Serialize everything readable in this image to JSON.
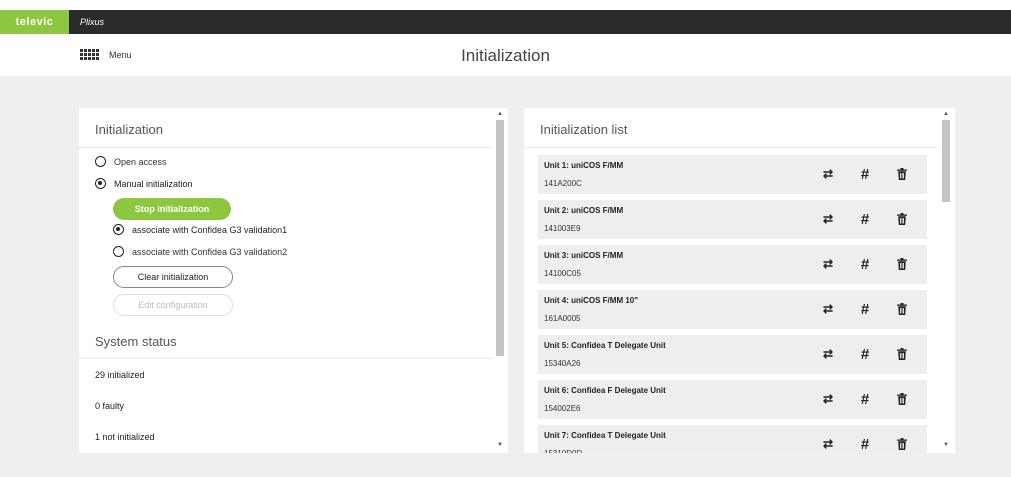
{
  "brand": {
    "logo": "televic",
    "app_name": "Plixus",
    "accent": "#8dc63f"
  },
  "header": {
    "menu_label": "Menu",
    "page_title": "Initialization"
  },
  "left_panel": {
    "title": "Initialization",
    "options": [
      {
        "label": "Open access",
        "checked": false
      },
      {
        "label": "Manual initialization",
        "checked": true
      }
    ],
    "stop_button": "Stop initialization",
    "associate_options": [
      {
        "label": "associate with Confidea G3 validation1",
        "checked": true
      },
      {
        "label": "associate with Confidea G3 validation2",
        "checked": false
      }
    ],
    "clear_button": "Clear initialization",
    "edit_button": "Edit configuration",
    "status_title": "System status",
    "status": [
      {
        "text": "29 initialized"
      },
      {
        "text": "0  faulty"
      },
      {
        "text": "1  not initialized"
      }
    ]
  },
  "right_panel": {
    "title": "Initialization list",
    "units": [
      {
        "name": "Unit 1: uniCOS F/MM",
        "serial": "141A200C"
      },
      {
        "name": "Unit 2: uniCOS F/MM",
        "serial": "141003E9"
      },
      {
        "name": "Unit 3: uniCOS F/MM",
        "serial": "14100C05"
      },
      {
        "name": "Unit 4: uniCOS F/MM 10\"",
        "serial": "161A0005"
      },
      {
        "name": "Unit 5: Confidea T Delegate Unit",
        "serial": "15340A26"
      },
      {
        "name": "Unit 6: Confidea F Delegate Unit",
        "serial": "154002E6"
      },
      {
        "name": "Unit 7: Confidea T Delegate Unit",
        "serial": "15310D0D"
      }
    ],
    "icons": [
      "swap-icon",
      "hash-icon",
      "trash-icon"
    ]
  }
}
